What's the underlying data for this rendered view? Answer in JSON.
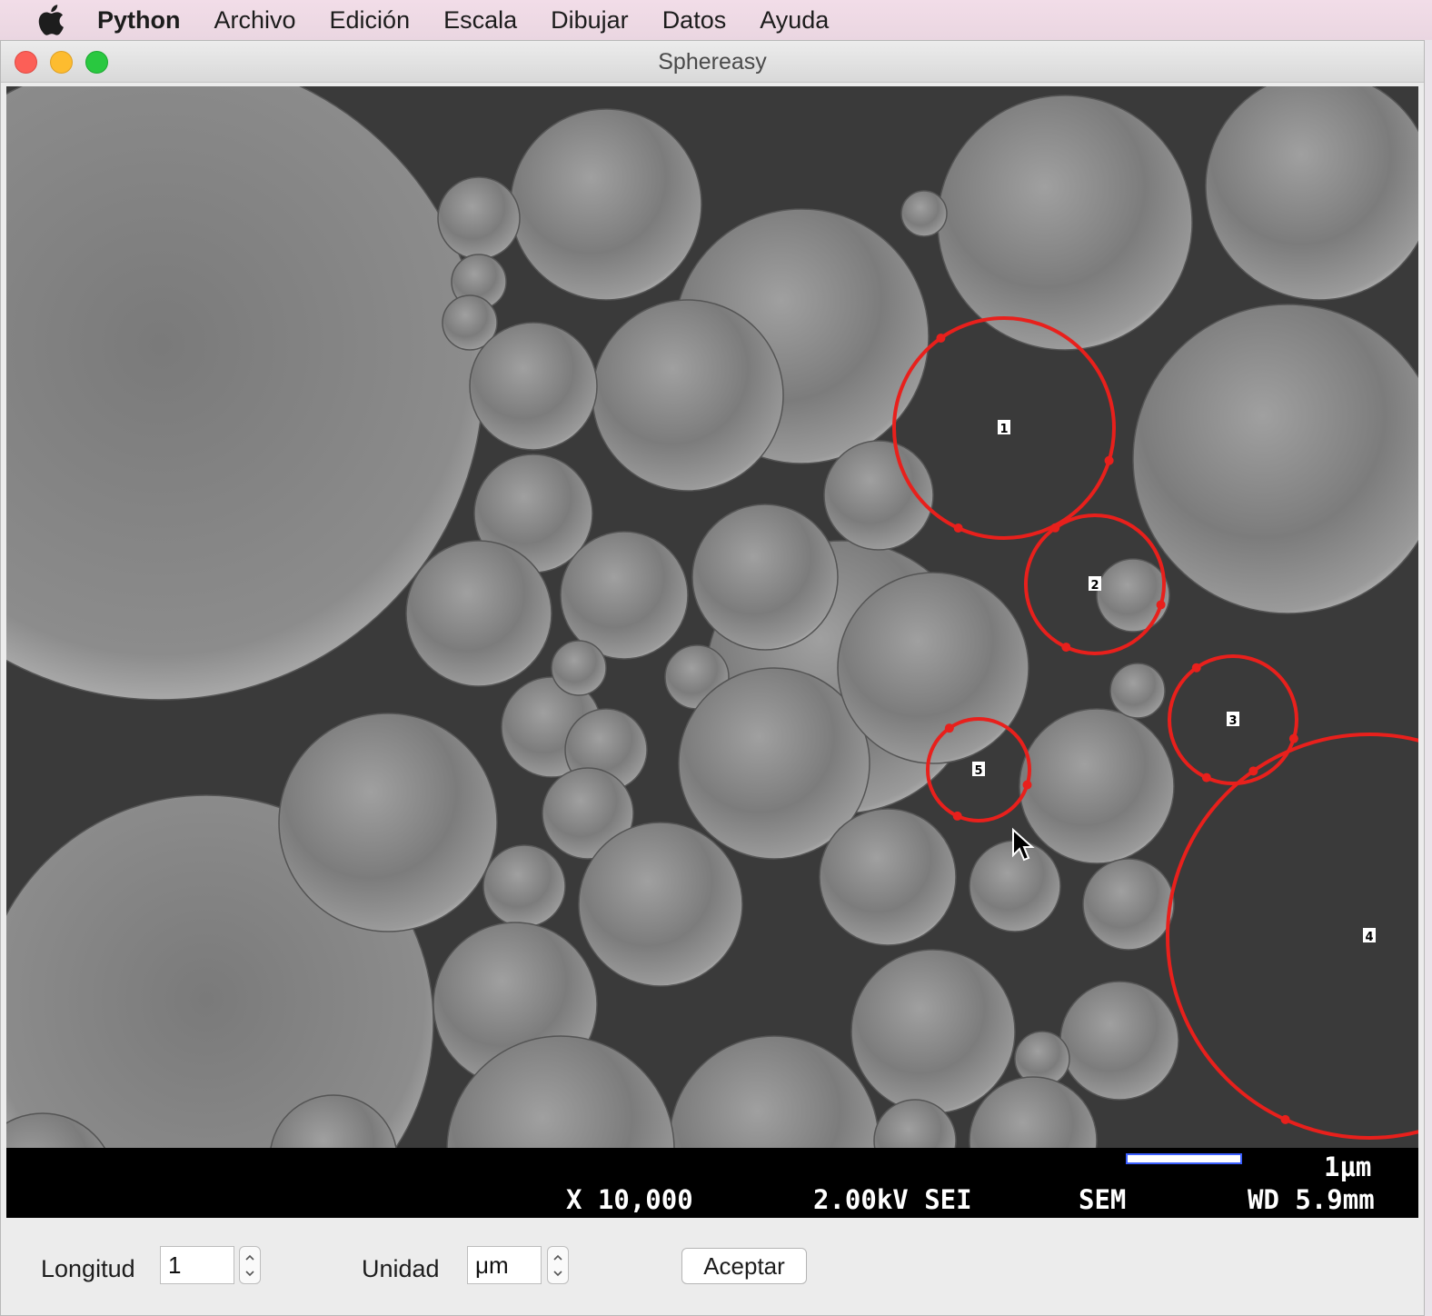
{
  "menubar": {
    "app_name": "Python",
    "items": [
      "Archivo",
      "Edición",
      "Escala",
      "Dibujar",
      "Datos",
      "Ayuda"
    ]
  },
  "window": {
    "title": "Sphereasy"
  },
  "image_info": {
    "scale_label": "1μm",
    "magnification": "X 10,000",
    "voltage_mode": "2.00kV SEI",
    "instrument": "SEM",
    "working_distance": "WD 5.9mm"
  },
  "annotations": [
    "1",
    "2",
    "3",
    "4",
    "5"
  ],
  "controls": {
    "length_label": "Longitud",
    "length_value": "1",
    "unit_label": "Unidad",
    "unit_value": "μm",
    "accept_label": "Aceptar"
  },
  "colors": {
    "annotation": "#e8201c",
    "scale_bar_border": "#3b5fff"
  }
}
